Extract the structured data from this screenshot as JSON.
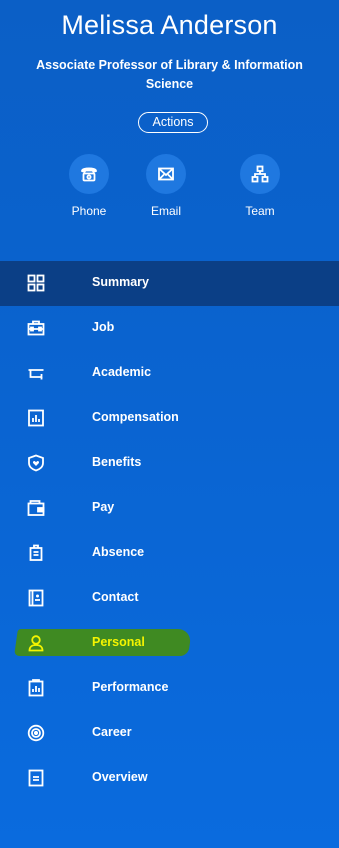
{
  "profile": {
    "name": "Melissa Anderson",
    "title": "Associate Professor of Library & Information Science",
    "actions_label": "Actions"
  },
  "quick_actions": [
    {
      "label": "Phone",
      "icon": "phone-icon"
    },
    {
      "label": "Email",
      "icon": "envelope-icon"
    },
    {
      "label": "Team",
      "icon": "org-chart-icon"
    }
  ],
  "nav": {
    "items": [
      {
        "label": "Summary",
        "icon": "grid-icon",
        "active": true
      },
      {
        "label": "Job",
        "icon": "briefcase-icon"
      },
      {
        "label": "Academic",
        "icon": "graduation-cap-icon"
      },
      {
        "label": "Compensation",
        "icon": "chart-icon"
      },
      {
        "label": "Benefits",
        "icon": "shield-heart-icon"
      },
      {
        "label": "Pay",
        "icon": "wallet-icon"
      },
      {
        "label": "Absence",
        "icon": "luggage-icon"
      },
      {
        "label": "Contact",
        "icon": "contact-book-icon"
      },
      {
        "label": "Personal",
        "icon": "person-icon",
        "highlighted": true
      },
      {
        "label": "Performance",
        "icon": "clipboard-chart-icon"
      },
      {
        "label": "Career",
        "icon": "target-icon"
      },
      {
        "label": "Overview",
        "icon": "document-icon"
      }
    ]
  },
  "colors": {
    "background": "#0a63cf",
    "active_row": "#0b3f86",
    "highlight_marker": "#3f8a22",
    "highlight_text": "#f4f400"
  }
}
